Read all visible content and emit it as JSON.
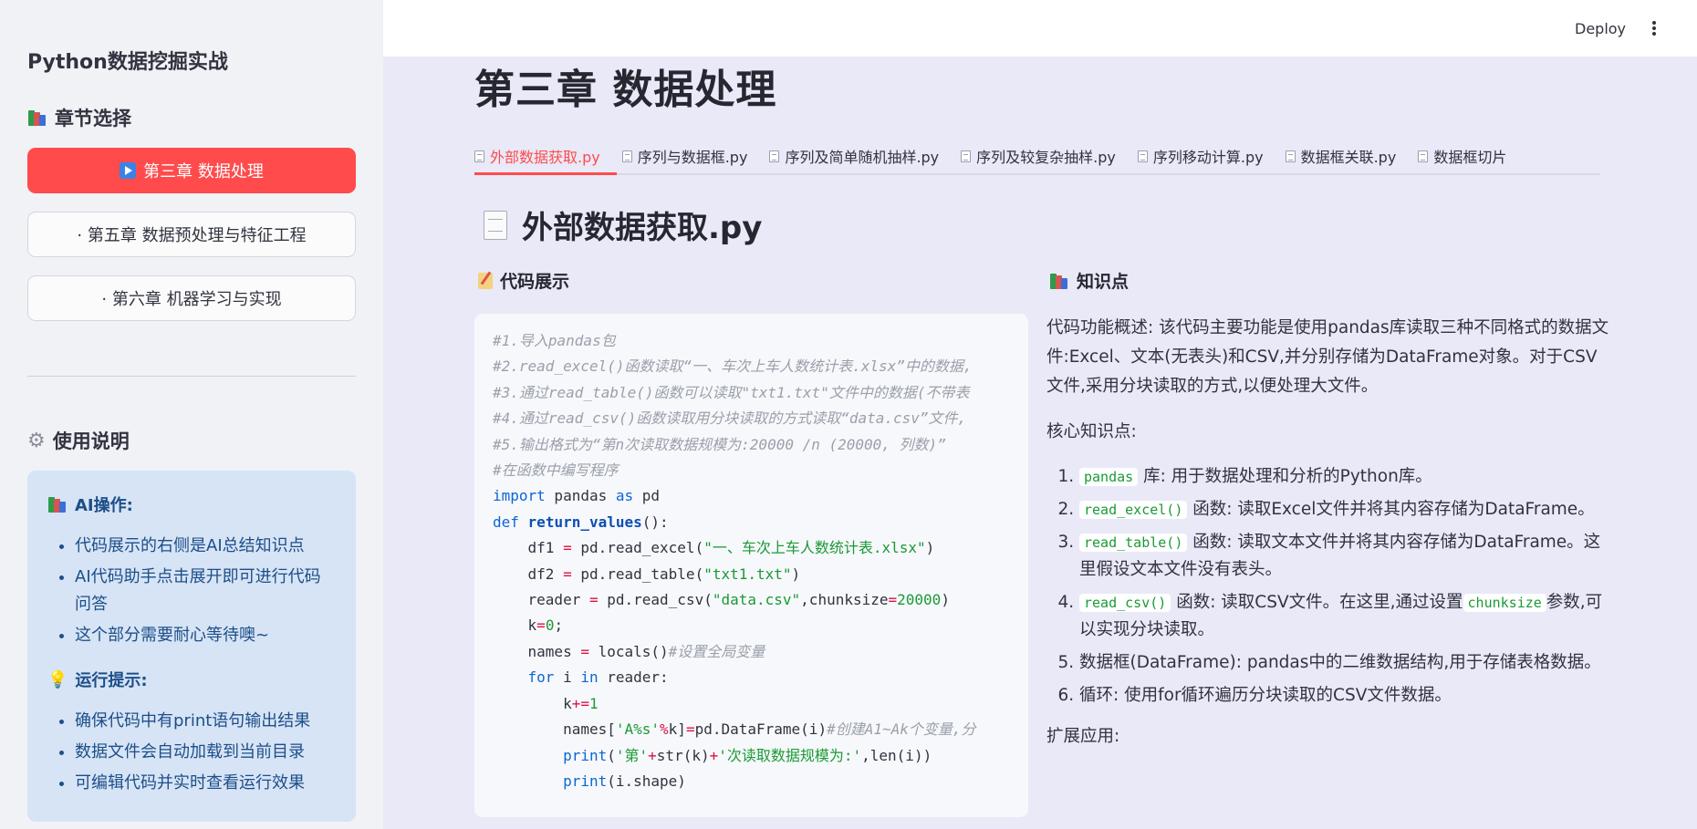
{
  "sidebar": {
    "app_title": "Python数据挖掘实战",
    "chapter_section_title": "章节选择",
    "chapters": [
      {
        "label": "第三章 数据处理",
        "active": true
      },
      {
        "label": "· 第五章 数据预处理与特征工程",
        "active": false
      },
      {
        "label": "· 第六章 机器学习与实现",
        "active": false
      }
    ],
    "usage_title": "使用说明",
    "info": {
      "ai_head": "AI操作:",
      "ai_items": [
        "代码展示的右侧是AI总结知识点",
        "AI代码助手点击展开即可进行代码问答",
        "这个部分需要耐心等待噢~"
      ],
      "run_head": "运行提示:",
      "run_items": [
        "确保代码中有print语句输出结果",
        "数据文件会自动加载到当前目录",
        "可编辑代码并实时查看运行效果"
      ]
    }
  },
  "header": {
    "deploy_label": "Deploy"
  },
  "main": {
    "page_title": "第三章 数据处理",
    "tabs": [
      "外部数据获取.py",
      "序列与数据框.py",
      "序列及简单随机抽样.py",
      "序列及较复杂抽样.py",
      "序列移动计算.py",
      "数据框关联.py",
      "数据框切片"
    ],
    "active_tab_index": 0,
    "file_title": "外部数据获取.py",
    "code_head": "代码展示",
    "knowledge_head": "知识点",
    "code": {
      "c1": "#1.导入pandas包",
      "c2": "#2.read_excel()函数读取“一、车次上车人数统计表.xlsx”中的数据,",
      "c3": "#3.通过read_table()函数可以读取\"txt1.txt\"文件中的数据(不带表",
      "c4": "#4.通过read_csv()函数读取用分块读取的方式读取“data.csv”文件,",
      "c5": "#5.输出格式为“第n次读取数据规模为:20000 /n (20000, 列数)”",
      "c6": "#在函数中编写程序",
      "import_kw": "import",
      "import_mod": " pandas ",
      "as_kw": "as",
      "import_alias": " pd",
      "def_kw": "def",
      "func_name": "return_values",
      "func_tail": "():",
      "l_df1a": "    df1 ",
      "l_df1b": "=",
      "l_df1c": " pd.read_excel(",
      "l_df1s": "\"一、车次上车人数统计表.xlsx\"",
      "l_df1e": ")",
      "l_df2a": "    df2 ",
      "l_df2b": "=",
      "l_df2c": " pd.read_table(",
      "l_df2s": "\"txt1.txt\"",
      "l_df2e": ")",
      "l_rda": "    reader ",
      "l_rdb": "=",
      "l_rdc": " pd.read_csv(",
      "l_rds": "\"data.csv\"",
      "l_rdd": ",chunksize",
      "l_rde": "=",
      "l_rdn": "20000",
      "l_rdf": ")",
      "l_ka": "    k",
      "l_kb": "=",
      "l_kn": "0",
      "l_kc": ";",
      "l_na": "    names ",
      "l_nb": "=",
      "l_nc": " locals()",
      "l_ncm": "#设置全局变量",
      "l_fora": "    ",
      "l_for": "for",
      "l_forb": " i ",
      "l_in": "in",
      "l_forc": " reader:",
      "l_kpa": "        k",
      "l_kpb": "+=",
      "l_kpn": "1",
      "l_nma": "        names[",
      "l_nms": "'A%s'",
      "l_nmo": "%",
      "l_nmb": "k]",
      "l_nmc": "=",
      "l_nmd": "pd.DataFrame(i)",
      "l_nmcm": "#创建A1~Ak个变量,分",
      "l_pra": "        ",
      "l_pr": "print",
      "l_prb": "(",
      "l_prs1": "'第'",
      "l_pro1": "+",
      "l_prc": "str(k)",
      "l_pro2": "+",
      "l_prs2": "'次读取数据规模为:'",
      "l_prd": ",len(i))",
      "l_psa": "        ",
      "l_ps": "print",
      "l_psb": "(i.shape)"
    },
    "knowledge": {
      "overview": "代码功能概述: 该代码主要功能是使用pandas库读取三种不同格式的数据文件:Excel、文本(无表头)和CSV,并分别存储为DataFrame对象。对于CSV文件,采用分块读取的方式,以便处理大文件。",
      "core_head": "核心知识点:",
      "items": [
        {
          "code": "pandas",
          "text": " 库: 用于数据处理和分析的Python库。"
        },
        {
          "code": "read_excel()",
          "text": " 函数: 读取Excel文件并将其内容存储为DataFrame。"
        },
        {
          "code": "read_table()",
          "text": " 函数: 读取文本文件并将其内容存储为DataFrame。这里假设文本文件没有表头。"
        },
        {
          "code": "read_csv()",
          "text": " 函数: 读取CSV文件。在这里,通过设置",
          "code2": "chunksize",
          "text2": "参数,可以实现分块读取。"
        },
        {
          "code": "",
          "text": "数据框(DataFrame): pandas中的二维数据结构,用于存储表格数据。"
        },
        {
          "code": "",
          "text": "循环: 使用for循环遍历分块读取的CSV文件数据。"
        }
      ],
      "ext_head": "扩展应用:"
    }
  },
  "colors": {
    "accent": "#ff4b4b",
    "info_bg": "#d6e4f5",
    "info_text": "#1d4e89",
    "main_bg": "#e9e9f8"
  }
}
